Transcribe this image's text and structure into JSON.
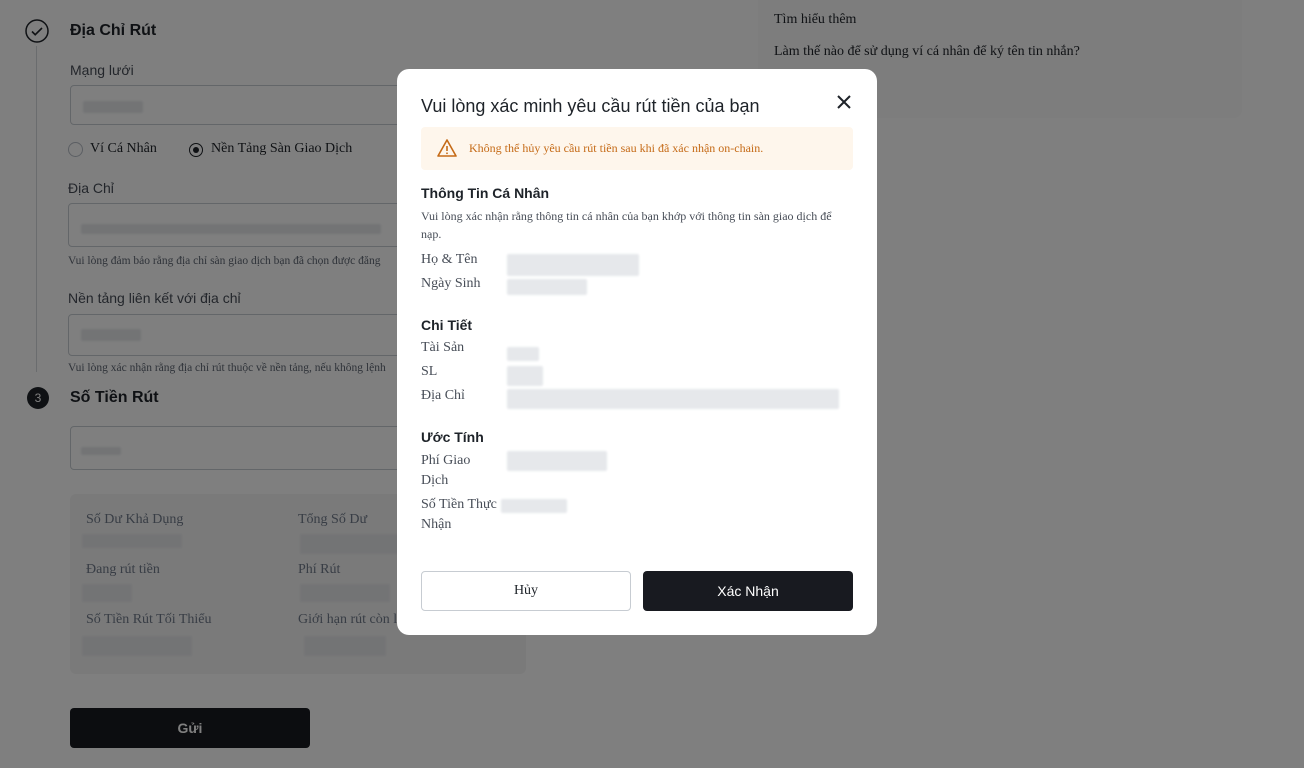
{
  "form": {
    "step2_title": "Địa Chỉ Rút",
    "network_label": "Mạng lưới",
    "radio_personal": "Ví Cá Nhân",
    "radio_exchange": "Nền Tảng Sàn Giao Dịch",
    "address_label": "Địa Chỉ",
    "address_hint": "Vui lòng đảm bảo rằng địa chỉ sàn giao dịch bạn đã chọn được đăng",
    "platform_label": "Nền tảng liên kết với địa chỉ",
    "platform_hint": "Vui lòng xác nhận rằng địa chỉ rút thuộc về nền tảng, nếu không lệnh",
    "step3_number": "3",
    "step3_title": "Số Tiền Rút",
    "balance": {
      "available_label": "Số Dư Khả Dụng",
      "total_label": "Tổng Số Dư",
      "withdrawing_label": "Đang rút tiền",
      "fee_label": "Phí Rút",
      "min_label": "Số Tiền Rút Tối Thiểu",
      "limit_label": "Giới hạn rút còn l"
    },
    "submit_label": "Gửi"
  },
  "side": {
    "learn_more": "Tìm hiểu thêm",
    "faq": "Làm thế nào để sử dụng ví cá nhân để ký tên tin nhắn?"
  },
  "modal": {
    "title": "Vui lòng xác minh yêu cầu rút tiền của bạn",
    "warning": "Không thể hủy yêu cầu rút tiền sau khi đã xác nhận on-chain.",
    "personal_title": "Thông Tin Cá Nhân",
    "personal_desc": "Vui lòng xác nhận rằng thông tin cá nhân của bạn khớp với thông tin sàn giao dịch để nạp.",
    "name_label": "Họ & Tên",
    "dob_label": "Ngày Sinh",
    "details_title": "Chi Tiết",
    "asset_label": "Tài Sản",
    "qty_label": "SL",
    "address_label": "Địa Chỉ",
    "estimate_title": "Ước Tính",
    "fee_label": "Phí Giao Dịch",
    "receive_label": "Số Tiền Thực Nhận",
    "cancel_label": "Hủy",
    "confirm_label": "Xác Nhận"
  },
  "icons": {
    "check": "check-circle-icon",
    "warning": "warning-triangle-icon",
    "close": "close-icon"
  },
  "colors": {
    "primary_button": "#181a20",
    "warning_bg": "#fef6ec",
    "warning_text": "#c56a16",
    "overlay": "rgba(0,0,0,0.5)"
  }
}
